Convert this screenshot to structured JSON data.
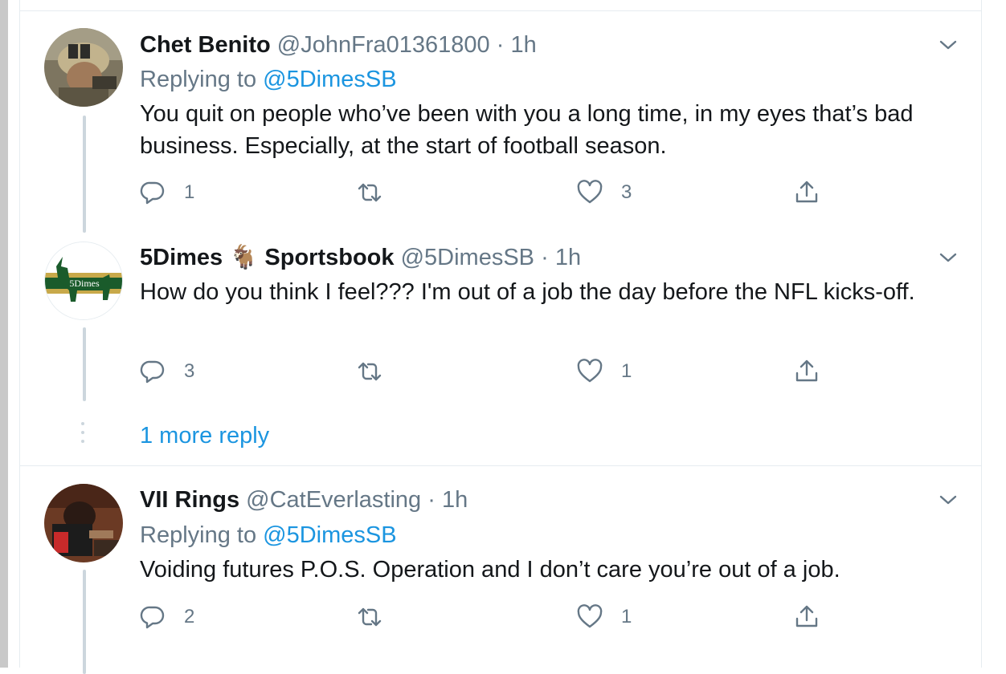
{
  "tweets": [
    {
      "name": "Chet Benito",
      "handle": "@JohnFra01361800",
      "dot": "·",
      "time": "1h",
      "replying_prefix": "Replying to",
      "replying_to": "@5DimesSB",
      "text": "You quit on people who’ve been with you a long time, in my eyes that’s bad business.  Especially, at the start of football season.",
      "reply_count": "1",
      "retweet_count": "",
      "like_count": "3",
      "avatar_icon": "soldier-photo-avatar"
    },
    {
      "name_part1": "5Dimes",
      "name_emoji": "🐐",
      "name_part2": "Sportsbook",
      "handle": "@5DimesSB",
      "dot": "·",
      "time": "1h",
      "text": "How do you think I feel??? I'm out of a job the day before the NFL kicks-off.",
      "reply_count": "3",
      "retweet_count": "",
      "like_count": "1",
      "logo_text": "5Dimes",
      "avatar_icon": "goat-logo-avatar"
    },
    {
      "name": "VII Rings",
      "handle": "@CatEverlasting",
      "dot": "·",
      "time": "1h",
      "replying_prefix": "Replying to",
      "replying_to": "@5DimesSB",
      "text": "Voiding futures P.O.S. Operation and I don’t care you’re out of a job.",
      "reply_count": "2",
      "retweet_count": "",
      "like_count": "1",
      "avatar_icon": "person-photo-avatar"
    }
  ],
  "more_replies": "1 more reply",
  "colors": {
    "link": "#1b95e0",
    "muted": "#657786",
    "text": "#14171a",
    "thread": "#ccd6dd"
  }
}
